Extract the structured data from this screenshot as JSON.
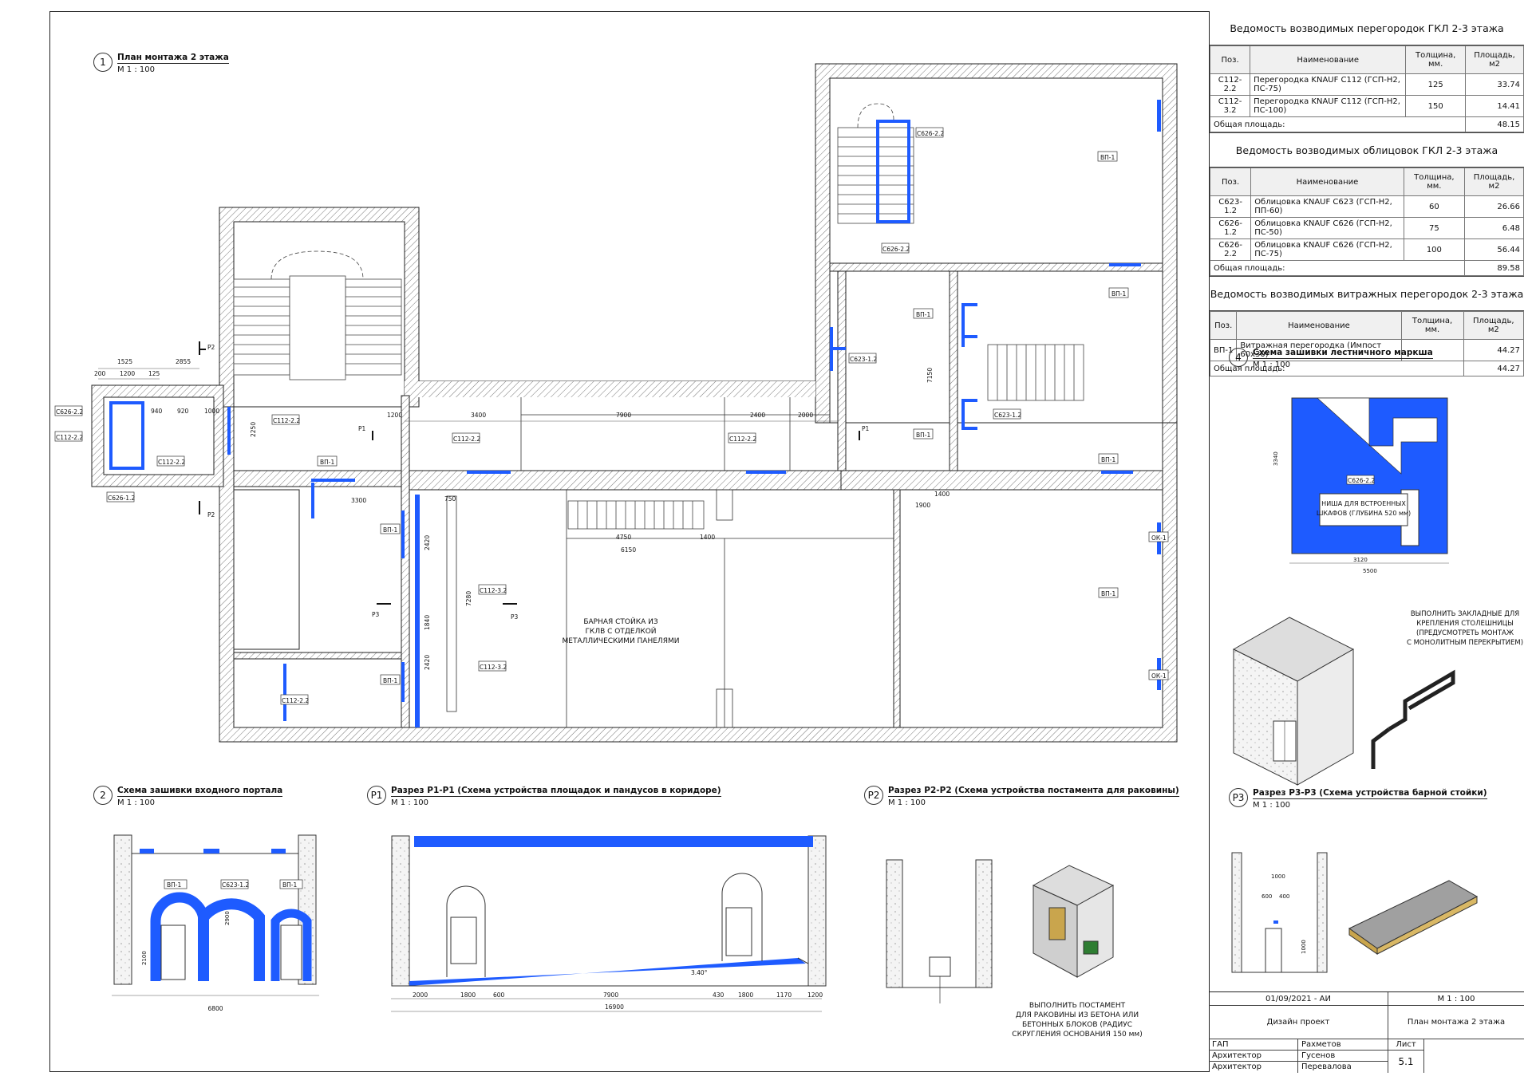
{
  "views": {
    "v1": {
      "num": "1",
      "title": "План монтажа 2 этажа",
      "scale": "М 1 : 100"
    },
    "v2": {
      "num": "2",
      "title": "Схема зашивки входного портала",
      "scale": "М 1 : 100"
    },
    "vp1": {
      "num": "Р1",
      "title": "Разрез Р1-Р1 (Схема устройства площадок и пандусов в коридоре)",
      "scale": "М 1 : 100"
    },
    "vp2": {
      "num": "Р2",
      "title": "Разрез Р2-Р2 (Схема устройства постамента для раковины)",
      "scale": "М 1 : 100"
    },
    "v4": {
      "num": "4",
      "title": "Схема зашивки лестничного маркша",
      "scale": "М 1 : 100"
    },
    "vp3": {
      "num": "Р3",
      "title": "Разрез Р3-Р3 (Схема устройства барной стойки)",
      "scale": "М 1 : 100"
    }
  },
  "schedule1": {
    "title": "Ведомость возводимых перегородок ГКЛ 2-3 этажа",
    "headers": [
      "Поз.",
      "Наименование",
      "Толщина, мм.",
      "Площадь, м2"
    ],
    "rows": [
      [
        "С112-2.2",
        "Перегородка KNAUF С112 (ГСП-Н2, ПС-75)",
        "125",
        "33.74"
      ],
      [
        "С112-3.2",
        "Перегородка KNAUF С112 (ГСП-Н2, ПС-100)",
        "150",
        "14.41"
      ]
    ],
    "total_label": "Общая площадь:",
    "total": "48.15"
  },
  "schedule2": {
    "title": "Ведомость возводимых облицовок ГКЛ 2-3 этажа",
    "headers": [
      "Поз.",
      "Наименование",
      "Толщина, мм.",
      "Площадь, м2"
    ],
    "rows": [
      [
        "С623-1.2",
        "Облицовка KNAUF С623 (ГСП-Н2, ПП-60)",
        "60",
        "26.66"
      ],
      [
        "С626-1.2",
        "Облицовка KNAUF С626 (ГСП-Н2, ПС-50)",
        "75",
        "6.48"
      ],
      [
        "С626-2.2",
        "Облицовка KNAUF С626 (ГСП-Н2, ПС-75)",
        "100",
        "56.44"
      ]
    ],
    "total_label": "Общая площадь:",
    "total": "89.58"
  },
  "schedule3": {
    "title": "Ведомость возводимых витражных перегородок 2-3 этажа",
    "headers": [
      "Поз.",
      "Наименование",
      "Толщина, мм.",
      "Площадь, м2"
    ],
    "rows": [
      [
        "ВП-1",
        "Витражная перегородка (Импост 60х30)",
        "",
        "44.27"
      ]
    ],
    "total_label": "Общая площадь:",
    "total": "44.27"
  },
  "plan_tags": {
    "vp1": "ВП-1",
    "ok1": "ОК-1",
    "c112_22": "С112-2.2",
    "c112_32": "С112-3.2",
    "c623_12": "С623-1.2",
    "c626_22": "С626-2.2",
    "c626_12": "С626-1.2",
    "p1": "Р1",
    "p2": "Р2",
    "p3": "Р3"
  },
  "plan_dims": {
    "d3400": "3400",
    "d7900": "7900",
    "d2400": "2400",
    "d2000": "2000",
    "d1200": "1200",
    "d1525": "1525",
    "d2855": "2855",
    "d200": "200",
    "d125": "125",
    "d940": "940",
    "d920": "920",
    "d1000": "1000",
    "d4750": "4750",
    "d1400": "1400",
    "d6150": "6150",
    "d750": "750",
    "d7280": "7280",
    "d2420": "2420",
    "d1840": "1840",
    "d3300": "3300",
    "d1900": "1900",
    "d7150": "7150",
    "d2250": "2250"
  },
  "notes": {
    "bar": [
      "БАРНАЯ СТОЙКА ИЗ",
      "ГКЛВ С ОТДЕЛКОЙ",
      "МЕТАЛЛИЧЕСКИМИ ПАНЕЛЯМИ"
    ],
    "niche": [
      "НИША ДЛЯ ВСТРОЕННЫХ",
      "ШКАФОВ (ГЛУБИНА 520 мм)"
    ],
    "embed": [
      "ВЫПОЛНИТЬ ЗАКЛАДНЫЕ ДЛЯ",
      "КРЕПЛЕНИЯ СТОЛЕШНИЦЫ",
      "(ПРЕДУСМОТРЕТЬ МОНТАЖ",
      "С МОНОЛИТНЫМ ПЕРЕКРЫТИЕМ)"
    ],
    "postament": [
      "ВЫПОЛНИТЬ ПОСТАМЕНТ",
      "ДЛЯ РАКОВИНЫ ИЗ БЕТОНА ИЛИ",
      "БЕТОННЫХ БЛОКОВ (РАДИУС",
      "СКРУГЛЕНИЯ ОСНОВАНИЯ 150 мм)"
    ]
  },
  "sec_dims": {
    "p1_total": "16900",
    "p1_a": "2000",
    "p1_b": "1800",
    "p1_c": "600",
    "p1_d": "7900",
    "p1_e": "430",
    "p1_f": "1800",
    "p1_g": "1170",
    "p1_h": "1200",
    "p1_slope": "3.40°",
    "v2_total": "6800",
    "v2_h": "2900",
    "v2_h2": "2100",
    "v4_total": "5500",
    "v4_a": "3120",
    "v4_h": "3340",
    "p3_a": "1000",
    "p3_b": "600",
    "p3_c": "400",
    "p3_h": "1000"
  },
  "stamp": {
    "date": "01/09/2021 - АИ",
    "scale": "М 1 : 100",
    "project": "Дизайн проект",
    "sheet_name": "План монтажа 2 этажа",
    "gap_role": "ГАП",
    "gap_name": "Рахметов",
    "arch1_role": "Архитектор",
    "arch1_name": "Гусенов",
    "arch2_role": "Архитектор",
    "arch2_name": "Перевалова",
    "sheet_label": "Лист",
    "sheet_num": "5.1"
  },
  "colors": {
    "partition": "#1e5bff",
    "wall_hatch": "#555555",
    "line": "#222222"
  }
}
